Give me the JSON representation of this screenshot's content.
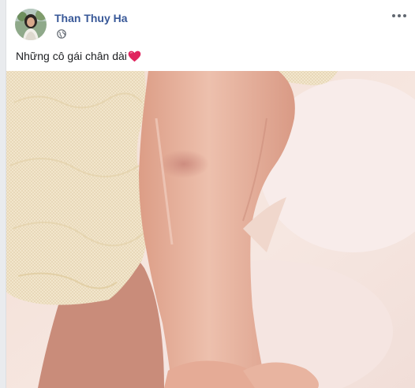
{
  "post": {
    "author": "Than Thuy Ha",
    "timestamp": "",
    "text": "Những cô gái chân dài",
    "emoji": "heart-icon",
    "privacy_icon": "globe-icon",
    "menu_icon": "more-options-icon"
  },
  "colors": {
    "author_link": "#385898",
    "heart": "#e0245e",
    "skin": "#e9b49c",
    "tulle": "#efe2c4"
  }
}
